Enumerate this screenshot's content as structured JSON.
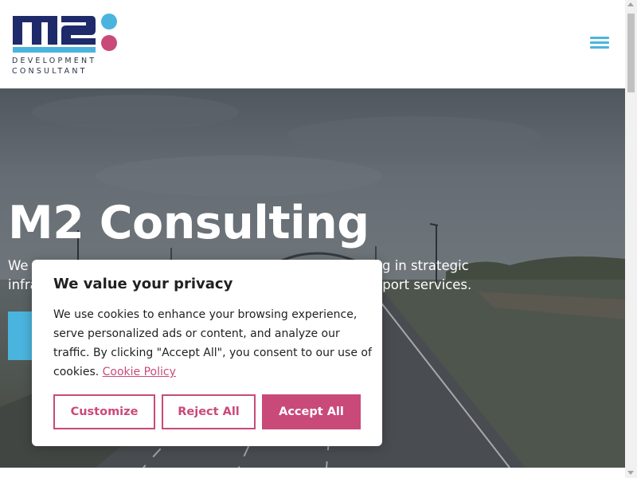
{
  "brand": {
    "logo_text": "m2",
    "tagline_line1": "DEVELOPMENT",
    "tagline_line2": "CONSULTANT",
    "colors": {
      "navy": "#1f2a6b",
      "cyan": "#4bb4de",
      "pink": "#c94a79"
    }
  },
  "header": {
    "menu_icon": "hamburger-menu-icon"
  },
  "hero": {
    "title": "M2 Consulting",
    "text": "We are a specialist development consultancy, specialising in strategic infrastructure, planning, design, delivery and project support services."
  },
  "cookie_banner": {
    "title": "We value your privacy",
    "body": "We use cookies to enhance your browsing experience, serve personalized ads or content, and analyze our traffic. By clicking \"Accept All\", you consent to our use of cookies. ",
    "policy_link": "Cookie Policy",
    "customize_label": "Customize",
    "reject_label": "Reject All",
    "accept_label": "Accept All",
    "accent_color": "#c94a79"
  }
}
